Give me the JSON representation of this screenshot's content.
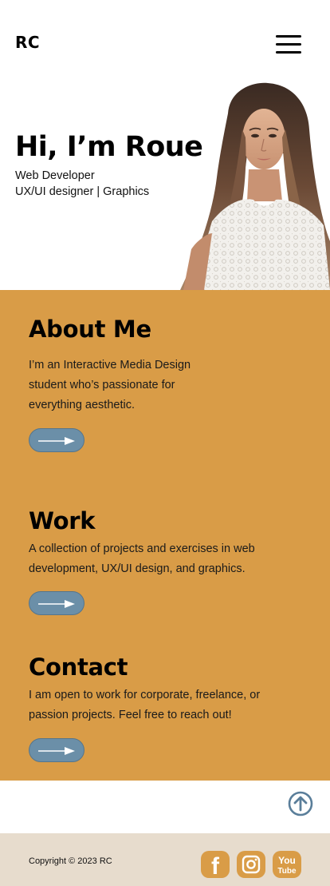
{
  "header": {
    "logo": "RC",
    "menu_icon": "hamburger-menu-icon"
  },
  "hero": {
    "title": "Hi, I’m Roue",
    "subtitle_line1": "Web Developer",
    "subtitle_line2": "UX/UI designer | Graphics",
    "image": "portrait-photo"
  },
  "sections": {
    "about": {
      "title": "About Me",
      "body": "I’m an Interactive Media Design student who’s passionate for everything aesthetic.",
      "button_icon": "arrow-right-icon"
    },
    "work": {
      "title": "Work",
      "body": "A collection of projects and exercises in web development, UX/UI design, and graphics.",
      "button_icon": "arrow-right-icon"
    },
    "contact": {
      "title": "Contact",
      "body": "I am open to work for corporate, freelance, or passion projects. Feel free to reach out!",
      "button_icon": "arrow-right-icon"
    }
  },
  "back_to_top": {
    "icon": "arrow-up-circle-icon"
  },
  "footer": {
    "copyright": "Copyright © 2023 RC",
    "social": [
      {
        "name": "facebook-icon",
        "glyph": "f"
      },
      {
        "name": "instagram-icon"
      },
      {
        "name": "youtube-icon",
        "text_top": "You",
        "text_bottom": "Tube"
      }
    ]
  },
  "colors": {
    "accent": "#d99c47",
    "button": "#6b8fa8",
    "footer_bg": "#e7dccd",
    "icon_blue": "#5a7e9a"
  }
}
